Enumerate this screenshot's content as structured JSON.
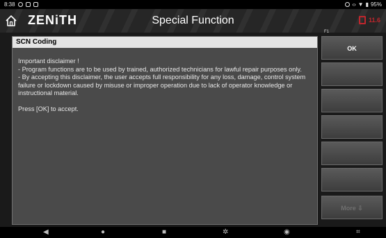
{
  "statusbar": {
    "time": "8:38",
    "battery": "95%"
  },
  "header": {
    "brand": "ZENiTH",
    "title": "Special Function",
    "vehicle_voltage": "11.6"
  },
  "panel": {
    "title": "SCN Coding",
    "body": "Important disclaimer !\n- Program functions are to be used by trained, authorized technicians for lawful repair purposes only.\n- By accepting this disclaimer, the user accepts full responsibility for any loss, damage, control system failure or lockdown caused by misuse or improper operation due to lack of operator knowledge or instructional material.\n\nPress [OK] to accept."
  },
  "buttons": [
    {
      "fkey": "F1",
      "label": "OK"
    },
    {
      "fkey": "",
      "label": ""
    },
    {
      "fkey": "",
      "label": ""
    },
    {
      "fkey": "",
      "label": ""
    },
    {
      "fkey": "",
      "label": ""
    },
    {
      "fkey": "",
      "label": ""
    },
    {
      "fkey": "",
      "label": "More ⇩"
    }
  ],
  "colors": {
    "alert": "#c0262d",
    "panel_bg": "#4a4a4a",
    "panel_title_bg": "#e4e4e4"
  }
}
